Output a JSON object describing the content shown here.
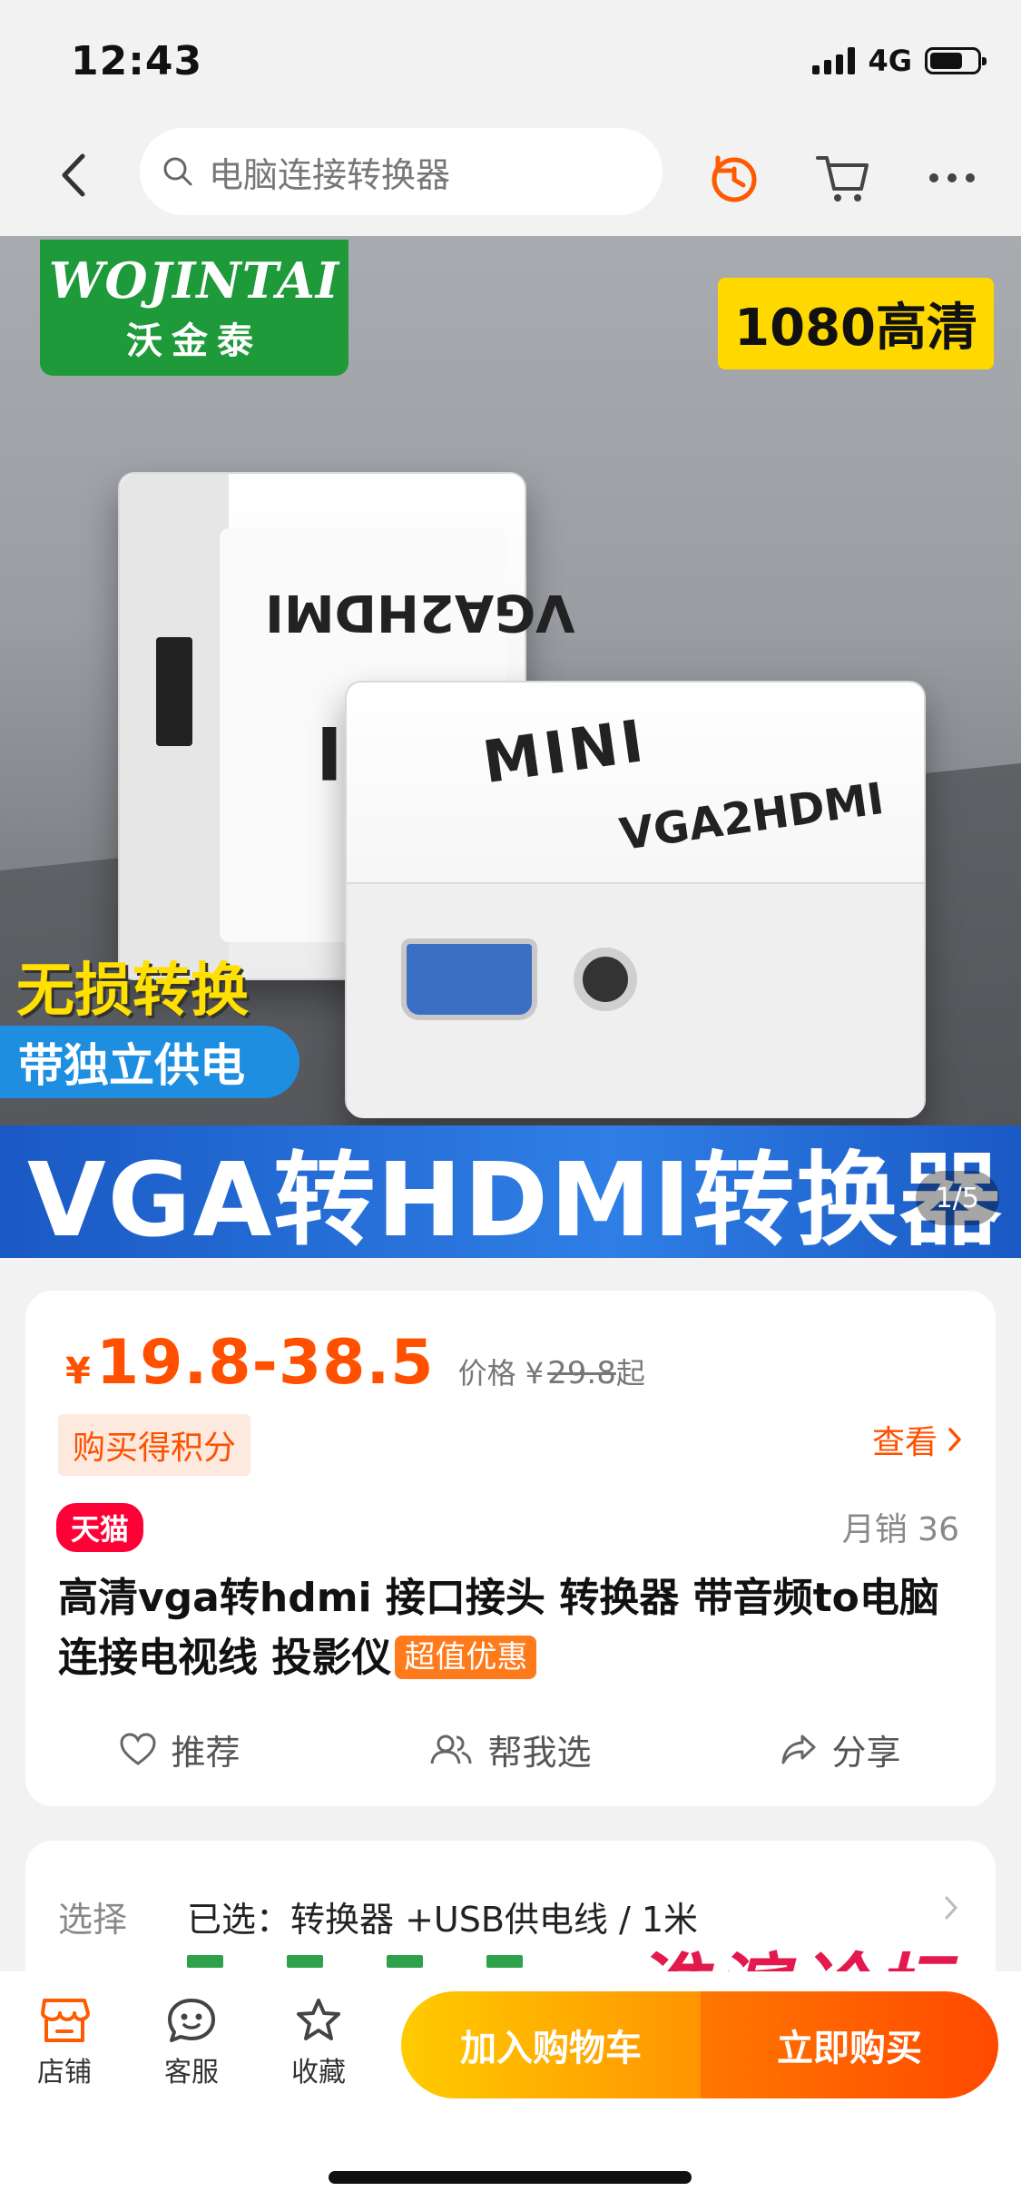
{
  "status": {
    "time": "12:43",
    "network": "4G"
  },
  "nav": {
    "search_placeholder": "电脑连接转换器"
  },
  "hero": {
    "brand_en": "WOJINTAI",
    "brand_cn": "沃金泰",
    "hd_badge": "1080高清",
    "device_label_1": "VGA2HDMI",
    "device_label_2": "MINI",
    "tag_lossless": "无损转换",
    "tag_power": "带独立供电",
    "banner": "VGA转HDMI转换器",
    "pager": "1/5"
  },
  "product": {
    "currency": "¥",
    "price_range": "19.8-38.5",
    "orig_label": "价格 ¥",
    "orig_price": "29.8",
    "orig_suffix": "起",
    "points_label": "购买得积分",
    "view_label": "查看",
    "store_badge": "天猫",
    "monthly_sales": "月销 36",
    "title": "高清vga转hdmi 接口接头 转换器 带音频to电脑连接电视线 投影仪",
    "hot_badge": "超值优惠",
    "actions": [
      {
        "label": "推荐",
        "icon": "heart-icon"
      },
      {
        "label": "帮我选",
        "icon": "users-icon"
      },
      {
        "label": "分享",
        "icon": "share-icon"
      }
    ]
  },
  "selection": {
    "label": "选择",
    "value": "已选：转换器 +USB供电线 / 1米"
  },
  "bottom_bar": {
    "items": [
      {
        "label": "店铺",
        "icon": "store-icon"
      },
      {
        "label": "客服",
        "icon": "chat-icon"
      },
      {
        "label": "收藏",
        "icon": "star-icon"
      }
    ],
    "add_to_cart": "加入购物车",
    "buy_now": "立即购买"
  },
  "watermark": "淮滨论坛",
  "colors": {
    "accent": "#ff5000",
    "tmall": "#ff0036",
    "cart": "#ffb000",
    "buy": "#ff5a00"
  }
}
